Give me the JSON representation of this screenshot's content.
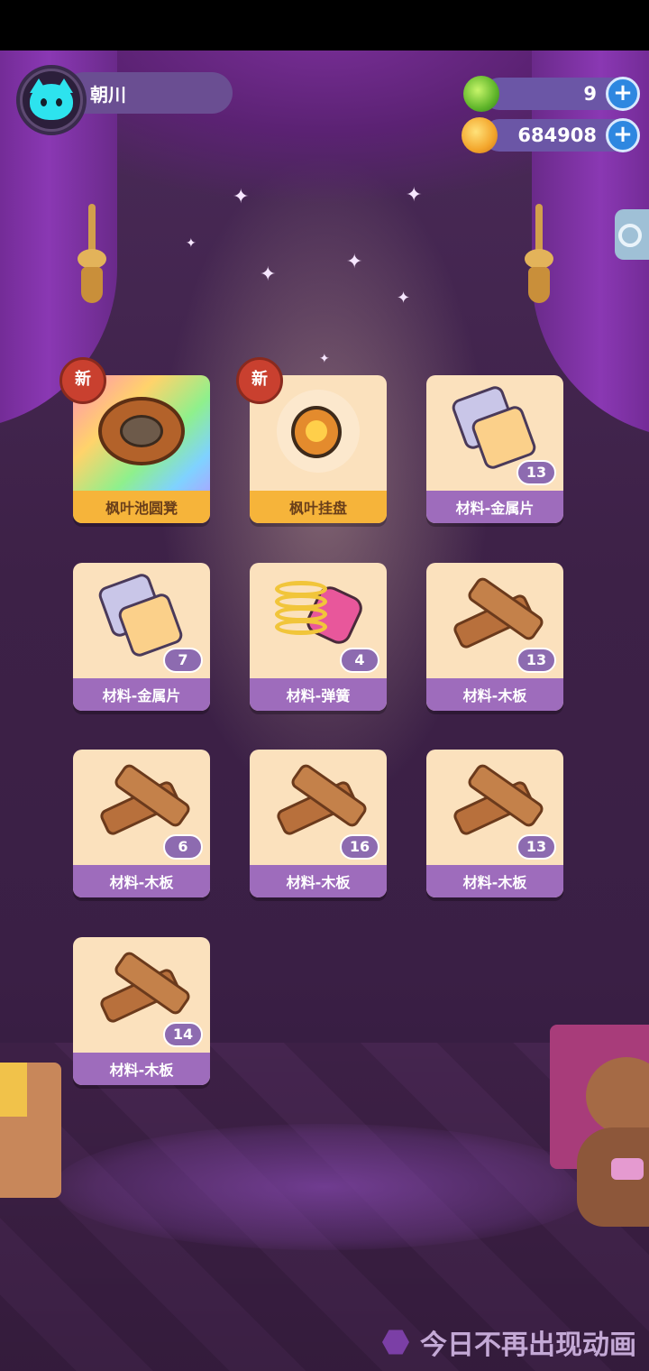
{
  "player": {
    "name": "朝川"
  },
  "currencies": [
    {
      "name": "gems",
      "value": "9",
      "icon": "green-gem-icon"
    },
    {
      "name": "coins",
      "value": "684908",
      "icon": "planet-coin-icon"
    }
  ],
  "badge_new": "新",
  "items": [
    {
      "label": "枫叶池圆凳",
      "count": "",
      "is_new": true,
      "icon": "maple-pond-stool-icon"
    },
    {
      "label": "枫叶挂盘",
      "count": "",
      "is_new": true,
      "icon": "maple-hanging-plate-icon"
    },
    {
      "label": "材料-金属片",
      "count": "13",
      "is_new": false,
      "icon": "metal-sheet-icon"
    },
    {
      "label": "材料-金属片",
      "count": "7",
      "is_new": false,
      "icon": "metal-sheet-icon"
    },
    {
      "label": "材料-弹簧",
      "count": "4",
      "is_new": false,
      "icon": "spring-icon"
    },
    {
      "label": "材料-木板",
      "count": "13",
      "is_new": false,
      "icon": "wood-plank-icon"
    },
    {
      "label": "材料-木板",
      "count": "6",
      "is_new": false,
      "icon": "wood-plank-icon"
    },
    {
      "label": "材料-木板",
      "count": "16",
      "is_new": false,
      "icon": "wood-plank-icon"
    },
    {
      "label": "材料-木板",
      "count": "13",
      "is_new": false,
      "icon": "wood-plank-icon"
    },
    {
      "label": "材料-木板",
      "count": "14",
      "is_new": false,
      "icon": "wood-plank-icon"
    }
  ],
  "footer": {
    "skip_animation_label": "今日不再出现动画"
  }
}
